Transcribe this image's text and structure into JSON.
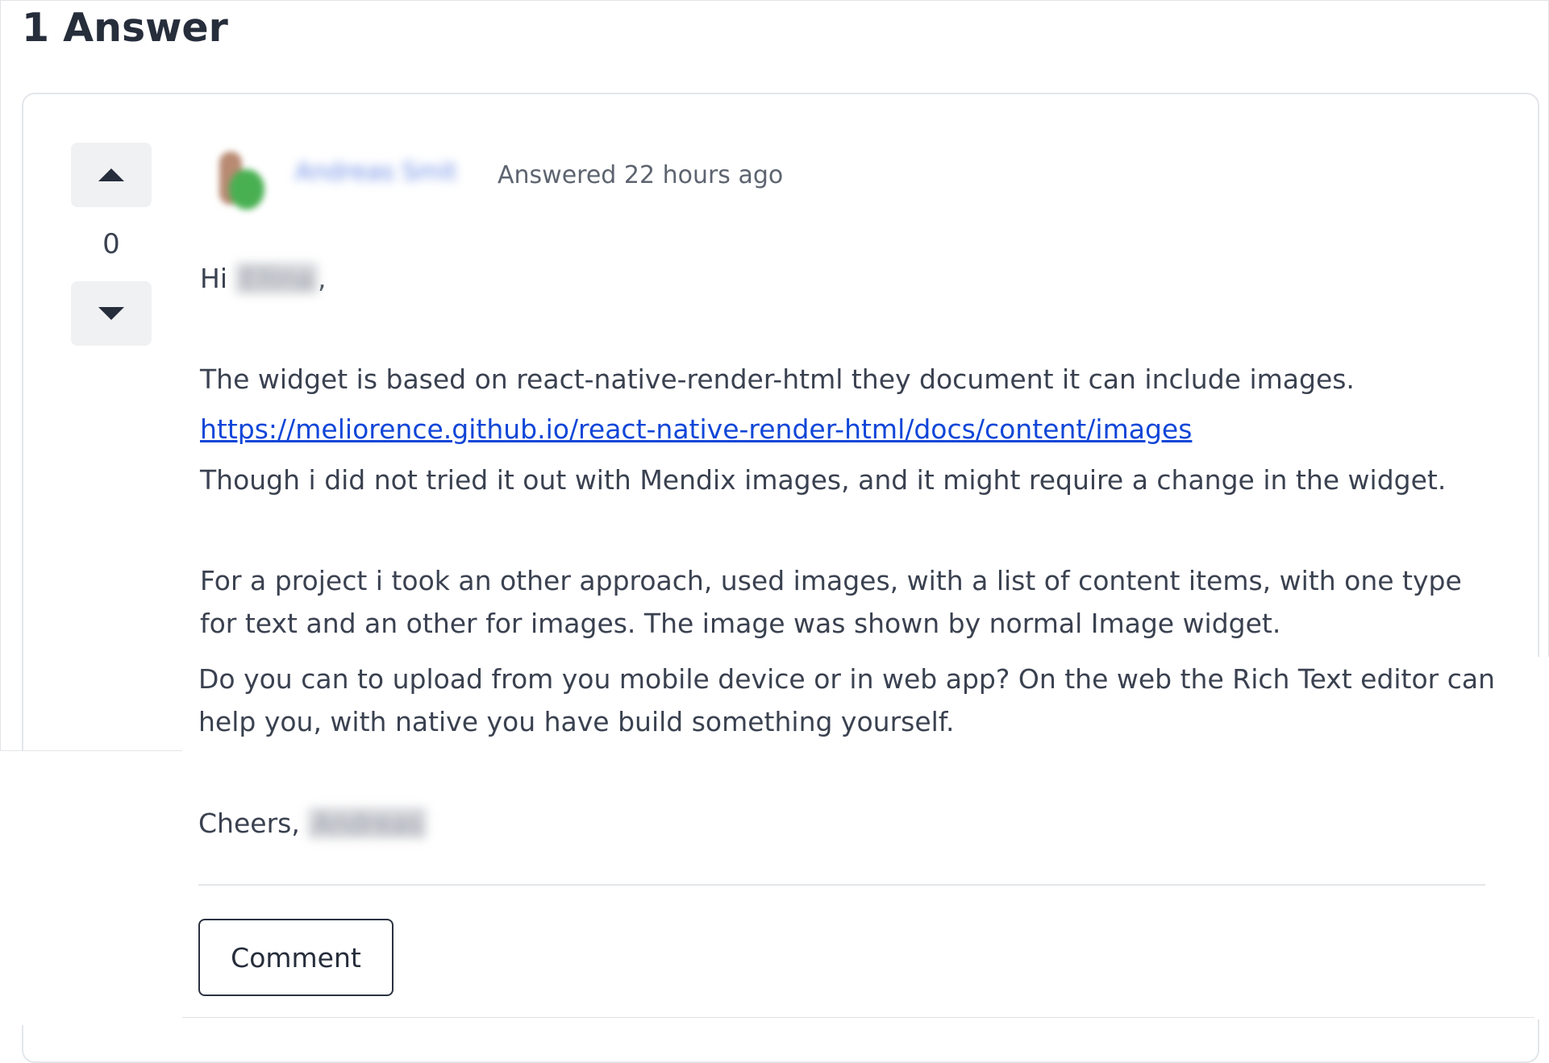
{
  "heading": "1 Answer",
  "vote": {
    "count": "0"
  },
  "author": {
    "name": "Andreas Smit",
    "meta": "Answered 22 hours ago"
  },
  "body": {
    "greeting_prefix": "Hi ",
    "greeting_name": "Ellina",
    "greeting_suffix": ",",
    "line1": "The widget is based on react-native-render-html they document it can include images.",
    "link": "https://meliorence.github.io/react-native-render-html/docs/content/images",
    "line2": "Though i did not tried it out with Mendix images, and it might require a change in the widget.",
    "line3": "For a project i took an other approach, used images, with a list of content items, with one type",
    "line4": "for text and an other for images. The image was shown by normal Image widget.",
    "line5": "Do you can to upload from you mobile device or in web app? On the web the Rich Text editor can",
    "line6": "help  you, with native you have build something yourself.",
    "signoff_prefix": "Cheers, ",
    "signoff_name": "Andreas"
  },
  "actions": {
    "comment_label": "Comment"
  },
  "colors": {
    "link": "#1046d8",
    "text": "#3a4150",
    "heading": "#262d3b"
  }
}
